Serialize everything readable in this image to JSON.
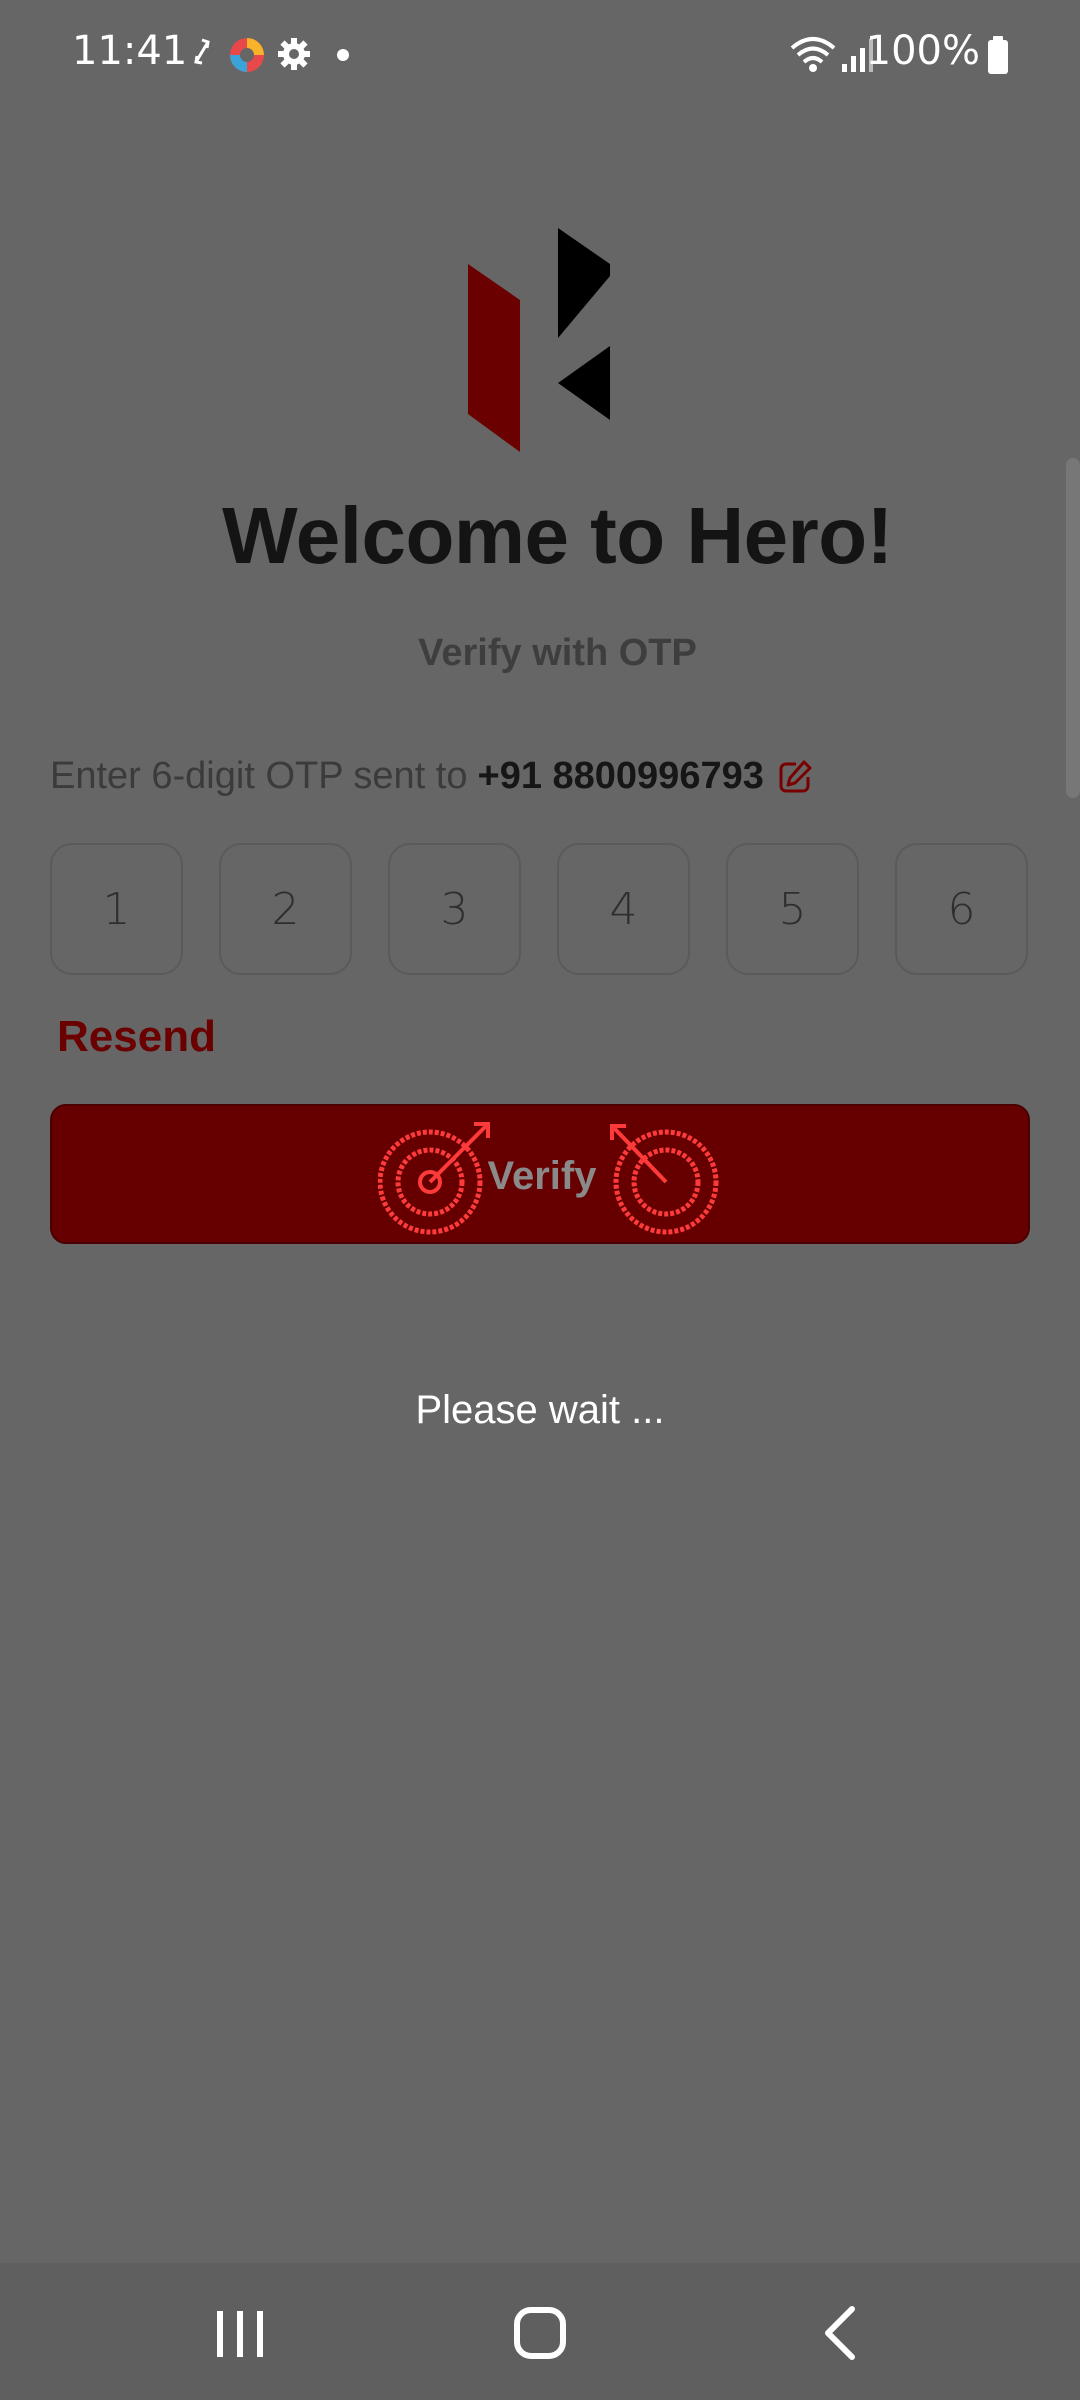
{
  "status_bar": {
    "time": "11:41",
    "battery": "100%"
  },
  "welcome": {
    "title": "Welcome to Hero!",
    "subtitle": "Verify with OTP"
  },
  "otp": {
    "prompt": "Enter 6-digit OTP sent to",
    "phone": "+91 8800996793",
    "digits": [
      "1",
      "2",
      "3",
      "4",
      "5",
      "6"
    ]
  },
  "actions": {
    "resend_label": "Resend",
    "verify_label": "Verify"
  },
  "loading": {
    "message": "Please wait ..."
  },
  "colors": {
    "brand_red": "#660000",
    "accent_red": "#6b0000",
    "overlay_bg": "#666666",
    "marker_red": "#ff3a3a"
  },
  "icons": {
    "status": [
      "auto-rotate-icon",
      "app-color-icon",
      "settings-gear-icon",
      "notification-dot-icon",
      "wifi-icon",
      "signal-icon",
      "battery-icon"
    ],
    "nav": [
      "recent-apps-icon",
      "home-icon",
      "back-icon"
    ]
  }
}
